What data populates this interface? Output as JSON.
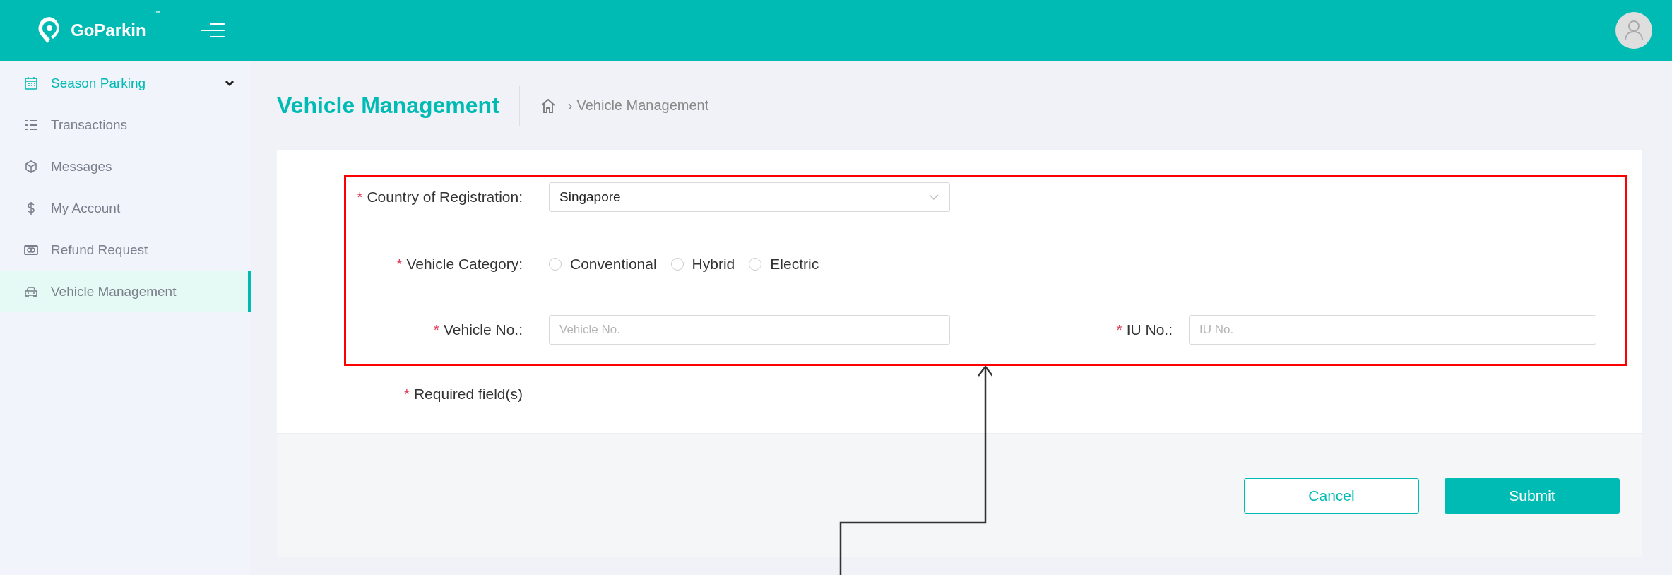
{
  "header": {
    "brand": "GoParkin",
    "trademark": "™"
  },
  "sidebar": {
    "items": [
      {
        "label": "Season Parking",
        "selected": false,
        "highlighted": true,
        "expandable": true
      },
      {
        "label": "Transactions",
        "selected": false,
        "highlighted": false,
        "expandable": false
      },
      {
        "label": "Messages",
        "selected": false,
        "highlighted": false,
        "expandable": false
      },
      {
        "label": "My Account",
        "selected": false,
        "highlighted": false,
        "expandable": false
      },
      {
        "label": "Refund Request",
        "selected": false,
        "highlighted": false,
        "expandable": false
      },
      {
        "label": "Vehicle Management",
        "selected": true,
        "highlighted": false,
        "expandable": false
      }
    ]
  },
  "page": {
    "title": "Vehicle Management",
    "breadcrumb": [
      "›",
      "Vehicle Management"
    ]
  },
  "form": {
    "required_mark": "*",
    "country": {
      "label": "Country of Registration:",
      "value": "Singapore"
    },
    "category": {
      "label": "Vehicle Category:",
      "options": [
        {
          "label": "Conventional",
          "selected": false
        },
        {
          "label": "Hybrid",
          "selected": false
        },
        {
          "label": "Electric",
          "selected": false
        }
      ]
    },
    "vehicle_no": {
      "label": "Vehicle No.:",
      "placeholder": "Vehicle No."
    },
    "iu_no": {
      "label": "IU No.:",
      "placeholder": "IU No."
    },
    "note": "Required field(s)",
    "buttons": [
      {
        "label": "Cancel",
        "kind": "secondary"
      },
      {
        "label": "Submit",
        "kind": "primary"
      }
    ]
  }
}
